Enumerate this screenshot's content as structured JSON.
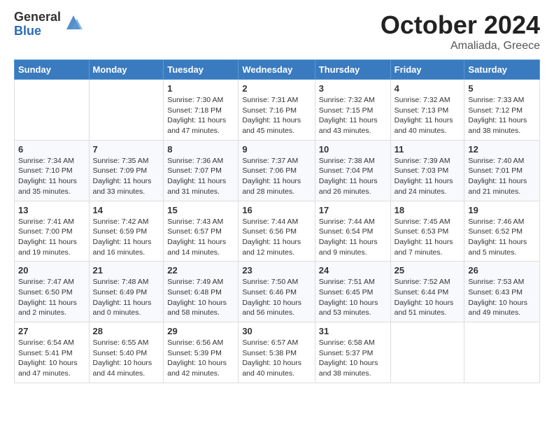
{
  "header": {
    "logo_general": "General",
    "logo_blue": "Blue",
    "month": "October 2024",
    "location": "Amaliada, Greece"
  },
  "columns": [
    "Sunday",
    "Monday",
    "Tuesday",
    "Wednesday",
    "Thursday",
    "Friday",
    "Saturday"
  ],
  "weeks": [
    [
      {
        "day": "",
        "info": ""
      },
      {
        "day": "",
        "info": ""
      },
      {
        "day": "1",
        "info": "Sunrise: 7:30 AM\nSunset: 7:18 PM\nDaylight: 11 hours and 47 minutes."
      },
      {
        "day": "2",
        "info": "Sunrise: 7:31 AM\nSunset: 7:16 PM\nDaylight: 11 hours and 45 minutes."
      },
      {
        "day": "3",
        "info": "Sunrise: 7:32 AM\nSunset: 7:15 PM\nDaylight: 11 hours and 43 minutes."
      },
      {
        "day": "4",
        "info": "Sunrise: 7:32 AM\nSunset: 7:13 PM\nDaylight: 11 hours and 40 minutes."
      },
      {
        "day": "5",
        "info": "Sunrise: 7:33 AM\nSunset: 7:12 PM\nDaylight: 11 hours and 38 minutes."
      }
    ],
    [
      {
        "day": "6",
        "info": "Sunrise: 7:34 AM\nSunset: 7:10 PM\nDaylight: 11 hours and 35 minutes."
      },
      {
        "day": "7",
        "info": "Sunrise: 7:35 AM\nSunset: 7:09 PM\nDaylight: 11 hours and 33 minutes."
      },
      {
        "day": "8",
        "info": "Sunrise: 7:36 AM\nSunset: 7:07 PM\nDaylight: 11 hours and 31 minutes."
      },
      {
        "day": "9",
        "info": "Sunrise: 7:37 AM\nSunset: 7:06 PM\nDaylight: 11 hours and 28 minutes."
      },
      {
        "day": "10",
        "info": "Sunrise: 7:38 AM\nSunset: 7:04 PM\nDaylight: 11 hours and 26 minutes."
      },
      {
        "day": "11",
        "info": "Sunrise: 7:39 AM\nSunset: 7:03 PM\nDaylight: 11 hours and 24 minutes."
      },
      {
        "day": "12",
        "info": "Sunrise: 7:40 AM\nSunset: 7:01 PM\nDaylight: 11 hours and 21 minutes."
      }
    ],
    [
      {
        "day": "13",
        "info": "Sunrise: 7:41 AM\nSunset: 7:00 PM\nDaylight: 11 hours and 19 minutes."
      },
      {
        "day": "14",
        "info": "Sunrise: 7:42 AM\nSunset: 6:59 PM\nDaylight: 11 hours and 16 minutes."
      },
      {
        "day": "15",
        "info": "Sunrise: 7:43 AM\nSunset: 6:57 PM\nDaylight: 11 hours and 14 minutes."
      },
      {
        "day": "16",
        "info": "Sunrise: 7:44 AM\nSunset: 6:56 PM\nDaylight: 11 hours and 12 minutes."
      },
      {
        "day": "17",
        "info": "Sunrise: 7:44 AM\nSunset: 6:54 PM\nDaylight: 11 hours and 9 minutes."
      },
      {
        "day": "18",
        "info": "Sunrise: 7:45 AM\nSunset: 6:53 PM\nDaylight: 11 hours and 7 minutes."
      },
      {
        "day": "19",
        "info": "Sunrise: 7:46 AM\nSunset: 6:52 PM\nDaylight: 11 hours and 5 minutes."
      }
    ],
    [
      {
        "day": "20",
        "info": "Sunrise: 7:47 AM\nSunset: 6:50 PM\nDaylight: 11 hours and 2 minutes."
      },
      {
        "day": "21",
        "info": "Sunrise: 7:48 AM\nSunset: 6:49 PM\nDaylight: 11 hours and 0 minutes."
      },
      {
        "day": "22",
        "info": "Sunrise: 7:49 AM\nSunset: 6:48 PM\nDaylight: 10 hours and 58 minutes."
      },
      {
        "day": "23",
        "info": "Sunrise: 7:50 AM\nSunset: 6:46 PM\nDaylight: 10 hours and 56 minutes."
      },
      {
        "day": "24",
        "info": "Sunrise: 7:51 AM\nSunset: 6:45 PM\nDaylight: 10 hours and 53 minutes."
      },
      {
        "day": "25",
        "info": "Sunrise: 7:52 AM\nSunset: 6:44 PM\nDaylight: 10 hours and 51 minutes."
      },
      {
        "day": "26",
        "info": "Sunrise: 7:53 AM\nSunset: 6:43 PM\nDaylight: 10 hours and 49 minutes."
      }
    ],
    [
      {
        "day": "27",
        "info": "Sunrise: 6:54 AM\nSunset: 5:41 PM\nDaylight: 10 hours and 47 minutes."
      },
      {
        "day": "28",
        "info": "Sunrise: 6:55 AM\nSunset: 5:40 PM\nDaylight: 10 hours and 44 minutes."
      },
      {
        "day": "29",
        "info": "Sunrise: 6:56 AM\nSunset: 5:39 PM\nDaylight: 10 hours and 42 minutes."
      },
      {
        "day": "30",
        "info": "Sunrise: 6:57 AM\nSunset: 5:38 PM\nDaylight: 10 hours and 40 minutes."
      },
      {
        "day": "31",
        "info": "Sunrise: 6:58 AM\nSunset: 5:37 PM\nDaylight: 10 hours and 38 minutes."
      },
      {
        "day": "",
        "info": ""
      },
      {
        "day": "",
        "info": ""
      }
    ]
  ]
}
